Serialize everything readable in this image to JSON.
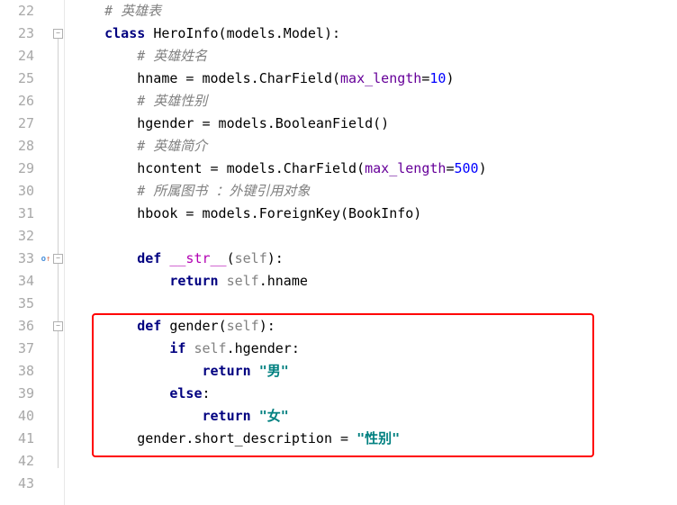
{
  "gutter": {
    "start": 22,
    "end": 43
  },
  "marker": {
    "o": "o",
    "arrow": "↑"
  },
  "code": {
    "l22": {
      "cmt": "# 英雄表"
    },
    "l23": {
      "kw1": "class ",
      "name": "HeroInfo(models.Model):"
    },
    "l24": {
      "cmt": "# 英雄姓名"
    },
    "l25": {
      "v": "hname = models.CharField(",
      "arg": "max_length",
      "eq": "=",
      "num": "10",
      "close": ")"
    },
    "l26": {
      "cmt": "# 英雄性别"
    },
    "l27": {
      "txt": "hgender = models.BooleanField()"
    },
    "l28": {
      "cmt": "# 英雄简介"
    },
    "l29": {
      "v": "hcontent = models.CharField(",
      "arg": "max_length",
      "eq": "=",
      "num": "500",
      "close": ")"
    },
    "l30": {
      "cmt": "# 所属图书 ：外键引用对象"
    },
    "l31": {
      "txt": "hbook = models.ForeignKey(BookInfo)"
    },
    "l33": {
      "kw": "def ",
      "name": "__str__",
      "params_open": "(",
      "self": "self",
      "params_close": "):"
    },
    "l34": {
      "kw": "return ",
      "self": "self",
      "rest": ".hname"
    },
    "l36": {
      "kw": "def ",
      "name": "gender",
      "params_open": "(",
      "self": "self",
      "params_close": "):"
    },
    "l37": {
      "kw": "if ",
      "self": "self",
      "rest": ".hgender:"
    },
    "l38": {
      "kw": "return ",
      "str": "\"男\""
    },
    "l39": {
      "kw": "else",
      "colon": ":"
    },
    "l40": {
      "kw": "return ",
      "str": "\"女\""
    },
    "l41": {
      "pre": "gender.short_description = ",
      "str": "\"性别\""
    }
  }
}
